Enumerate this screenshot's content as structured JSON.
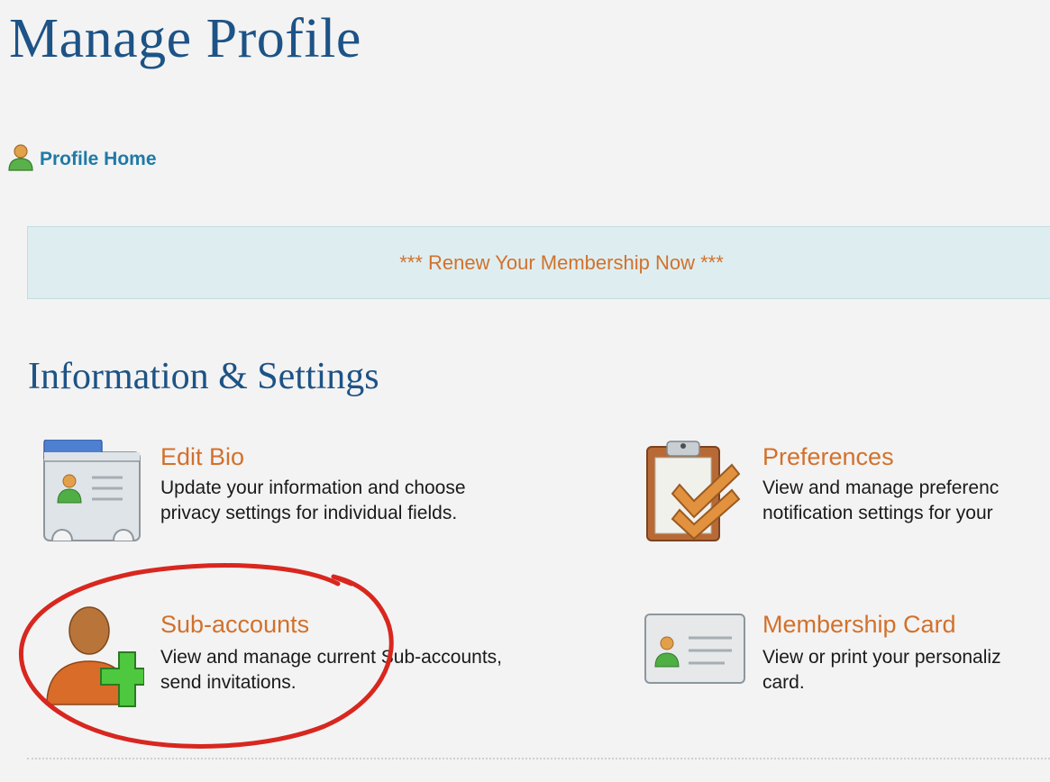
{
  "header": {
    "title": "Manage Profile"
  },
  "profile_home": {
    "label": "Profile Home",
    "icon": "user-icon"
  },
  "banner": {
    "text": "*** Renew Your Membership Now ***"
  },
  "section": {
    "title": "Information & Settings"
  },
  "tiles": {
    "edit_bio": {
      "title": "Edit Bio",
      "desc_line1": "Update your information and choose",
      "desc_line2": "privacy settings for individual fields.",
      "icon": "contact-card-icon"
    },
    "preferences": {
      "title": "Preferences",
      "desc_line1": "View and manage preferenc",
      "desc_line2": "notification settings for your",
      "icon": "clipboard-checklist-icon"
    },
    "sub_accounts": {
      "title": "Sub-accounts",
      "desc_line1": "View and manage current Sub-accounts,",
      "desc_line2": "send invitations.",
      "icon": "add-user-icon"
    },
    "membership_card": {
      "title": "Membership Card",
      "desc_line1": "View or print your personaliz",
      "desc_line2": "card.",
      "icon": "id-card-icon"
    }
  },
  "colors": {
    "heading": "#1d5386",
    "link_orange": "#d2712c",
    "link_blue": "#1f7aa6",
    "banner_bg": "#deeef0",
    "annotation_red": "#d8271f"
  }
}
